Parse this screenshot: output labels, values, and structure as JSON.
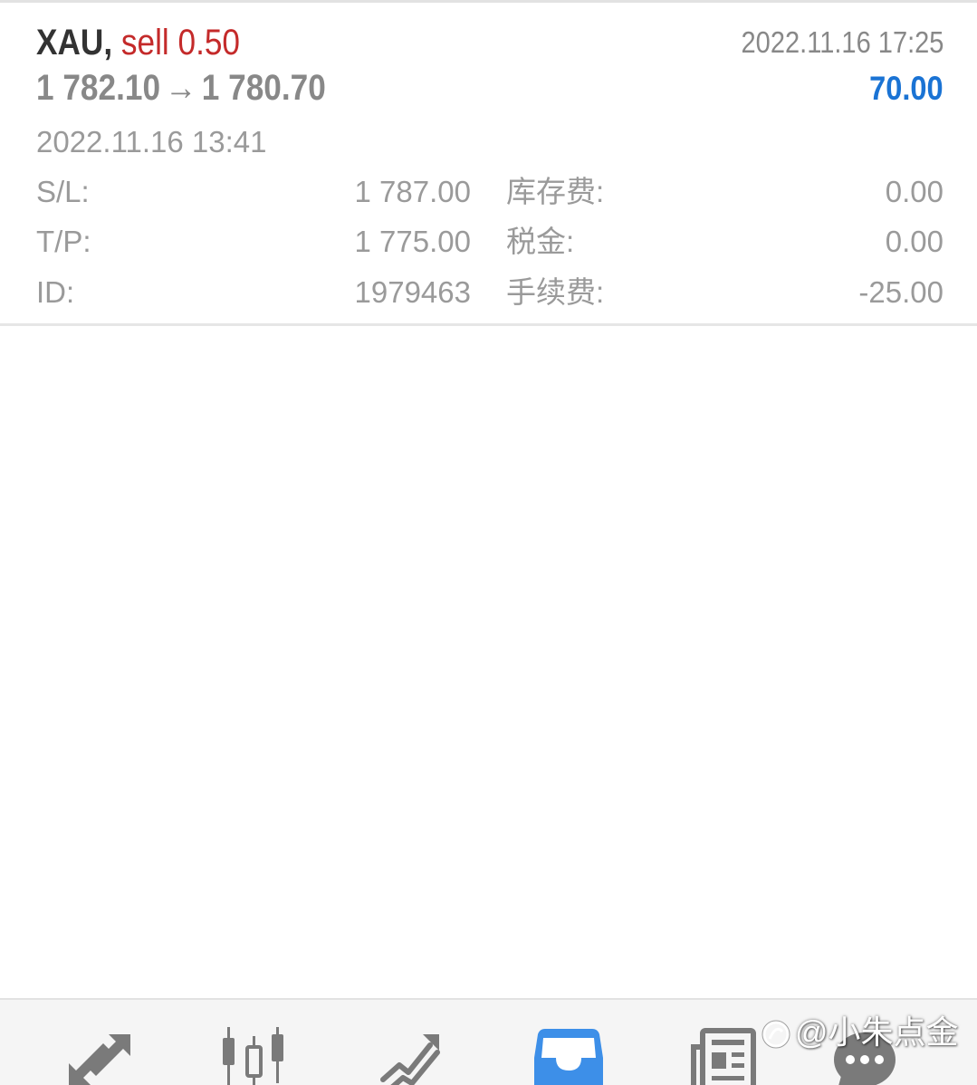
{
  "trade": {
    "symbol": "XAU,",
    "type_volume": "sell 0.50",
    "close_time": "2022.11.16 17:25",
    "open_price": "1 782.10",
    "arrow": "→",
    "close_price": "1 780.70",
    "profit": "70.00",
    "open_time": "2022.11.16 13:41",
    "details": {
      "sl_label": "S/L:",
      "sl_value": "1 787.00",
      "tp_label": "T/P:",
      "tp_value": "1 775.00",
      "id_label": "ID:",
      "id_value": "1979463",
      "swap_label": "库存费:",
      "swap_value": "0.00",
      "tax_label": "税金:",
      "tax_value": "0.00",
      "commission_label": "手续费:",
      "commission_value": "-25.00"
    }
  },
  "colors": {
    "sell": "#c42a2a",
    "profit": "#1a73d4",
    "active_nav": "#3d8fe8",
    "nav_icon": "#7a7a7a"
  },
  "bottom_nav": {
    "items": [
      {
        "icon": "quotes-arrows-icon",
        "active": false
      },
      {
        "icon": "candlestick-chart-icon",
        "active": false
      },
      {
        "icon": "trade-trend-icon",
        "active": false
      },
      {
        "icon": "history-inbox-icon",
        "active": true
      },
      {
        "icon": "news-icon",
        "active": false
      },
      {
        "icon": "chat-icon",
        "active": false
      }
    ]
  },
  "watermark": {
    "text": "@小朱点金"
  }
}
